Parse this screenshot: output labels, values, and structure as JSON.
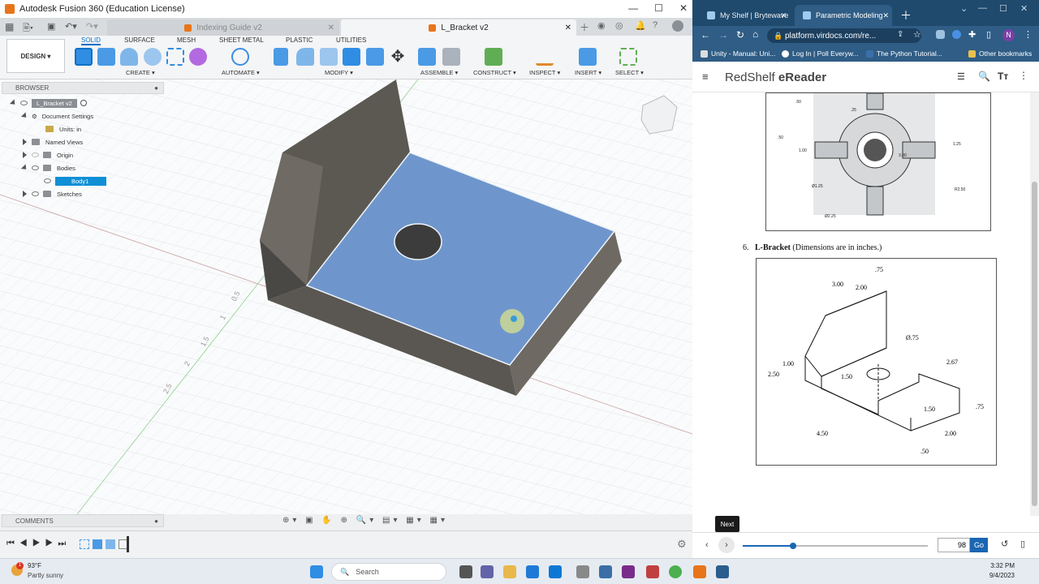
{
  "fusion": {
    "title": "Autodesk Fusion 360 (Education License)",
    "tabs": [
      {
        "label": "Indexing Guide v2"
      },
      {
        "label": "L_Bracket v2"
      }
    ],
    "design_label": "DESIGN ▾",
    "ribbon_tabs": [
      "SOLID",
      "SURFACE",
      "MESH",
      "SHEET METAL",
      "PLASTIC",
      "UTILITIES"
    ],
    "groups": [
      "CREATE ▾",
      "AUTOMATE ▾",
      "MODIFY ▾",
      "ASSEMBLE ▾",
      "CONSTRUCT ▾",
      "INSPECT ▾",
      "INSERT ▾",
      "SELECT ▾"
    ],
    "browser": {
      "title": "BROWSER",
      "items": [
        "L_Bracket v2",
        "Document Settings",
        "Units: in",
        "Named Views",
        "Origin",
        "Bodies",
        "Body1",
        "Sketches"
      ]
    },
    "comments_label": "COMMENTS",
    "axis_ticks": [
      "0.5",
      "1",
      "1.5",
      "2",
      "2.5"
    ],
    "colors": {
      "accent": "#0e6fc7",
      "face_selected": "#6f96cc",
      "body": "#6e6a62"
    }
  },
  "chrome": {
    "tabs": [
      {
        "label": "My Shelf | Brytewave"
      },
      {
        "label": "Parametric Modeling"
      }
    ],
    "url": "platform.virdocs.com/re...",
    "profile_initial": "N",
    "bookmarks": [
      "Unity - Manual: Uni...",
      "Log In | Poll Everyw...",
      "The Python Tutorial...",
      "Other bookmarks"
    ],
    "brand_a": "RedShelf",
    "brand_b": "eReader",
    "exercise_number": "6.",
    "exercise_title": "L-Bracket",
    "exercise_note": "(Dimensions are in inches.)",
    "top_figure_dims": [
      ".50",
      "1.25",
      "3.00",
      ".25",
      "1.00",
      "R2.50",
      "Ø1.25",
      "Ø2.25"
    ],
    "bracket_dims": [
      ".75",
      "3.00",
      "2.00",
      "Ø.75",
      "2.50",
      "1.00",
      "1.50",
      "2.67",
      "1.50",
      ".75",
      "4.50",
      "2.00",
      ".50"
    ],
    "tooltip": "Next",
    "page_number": "98",
    "go_label": "Go"
  },
  "taskbar": {
    "temperature": "93°F",
    "weather": "Partly sunny",
    "search_label": "Search",
    "time": "3:32 PM",
    "date": "9/4/2023"
  }
}
